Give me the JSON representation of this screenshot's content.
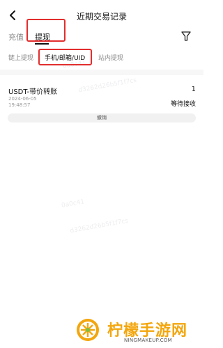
{
  "header": {
    "title": "近期交易记录",
    "back_icon": "chevron-left-icon"
  },
  "main_tabs": {
    "recharge": "充值",
    "withdraw": "提现",
    "active": "withdraw",
    "filter_icon": "filter-icon"
  },
  "sub_tabs": {
    "chain": "链上提现",
    "phone": "手机/邮箱/UID",
    "internal": "站内提现",
    "active": "phone"
  },
  "record": {
    "name": "USDT-带价转账",
    "amount": "1",
    "date": "2024-06-05",
    "time": "19:48:57",
    "status": "等待接收",
    "cancel_label": "撤销"
  },
  "watermark": {
    "line1": "0a0c41",
    "line2": "d3262d26b5f1f7cs"
  },
  "brand": {
    "name": "柠檬手游网",
    "url": "NINGMAKEUP.COM",
    "color": "#f3a60d"
  },
  "annotation_color": "#e22e2e"
}
